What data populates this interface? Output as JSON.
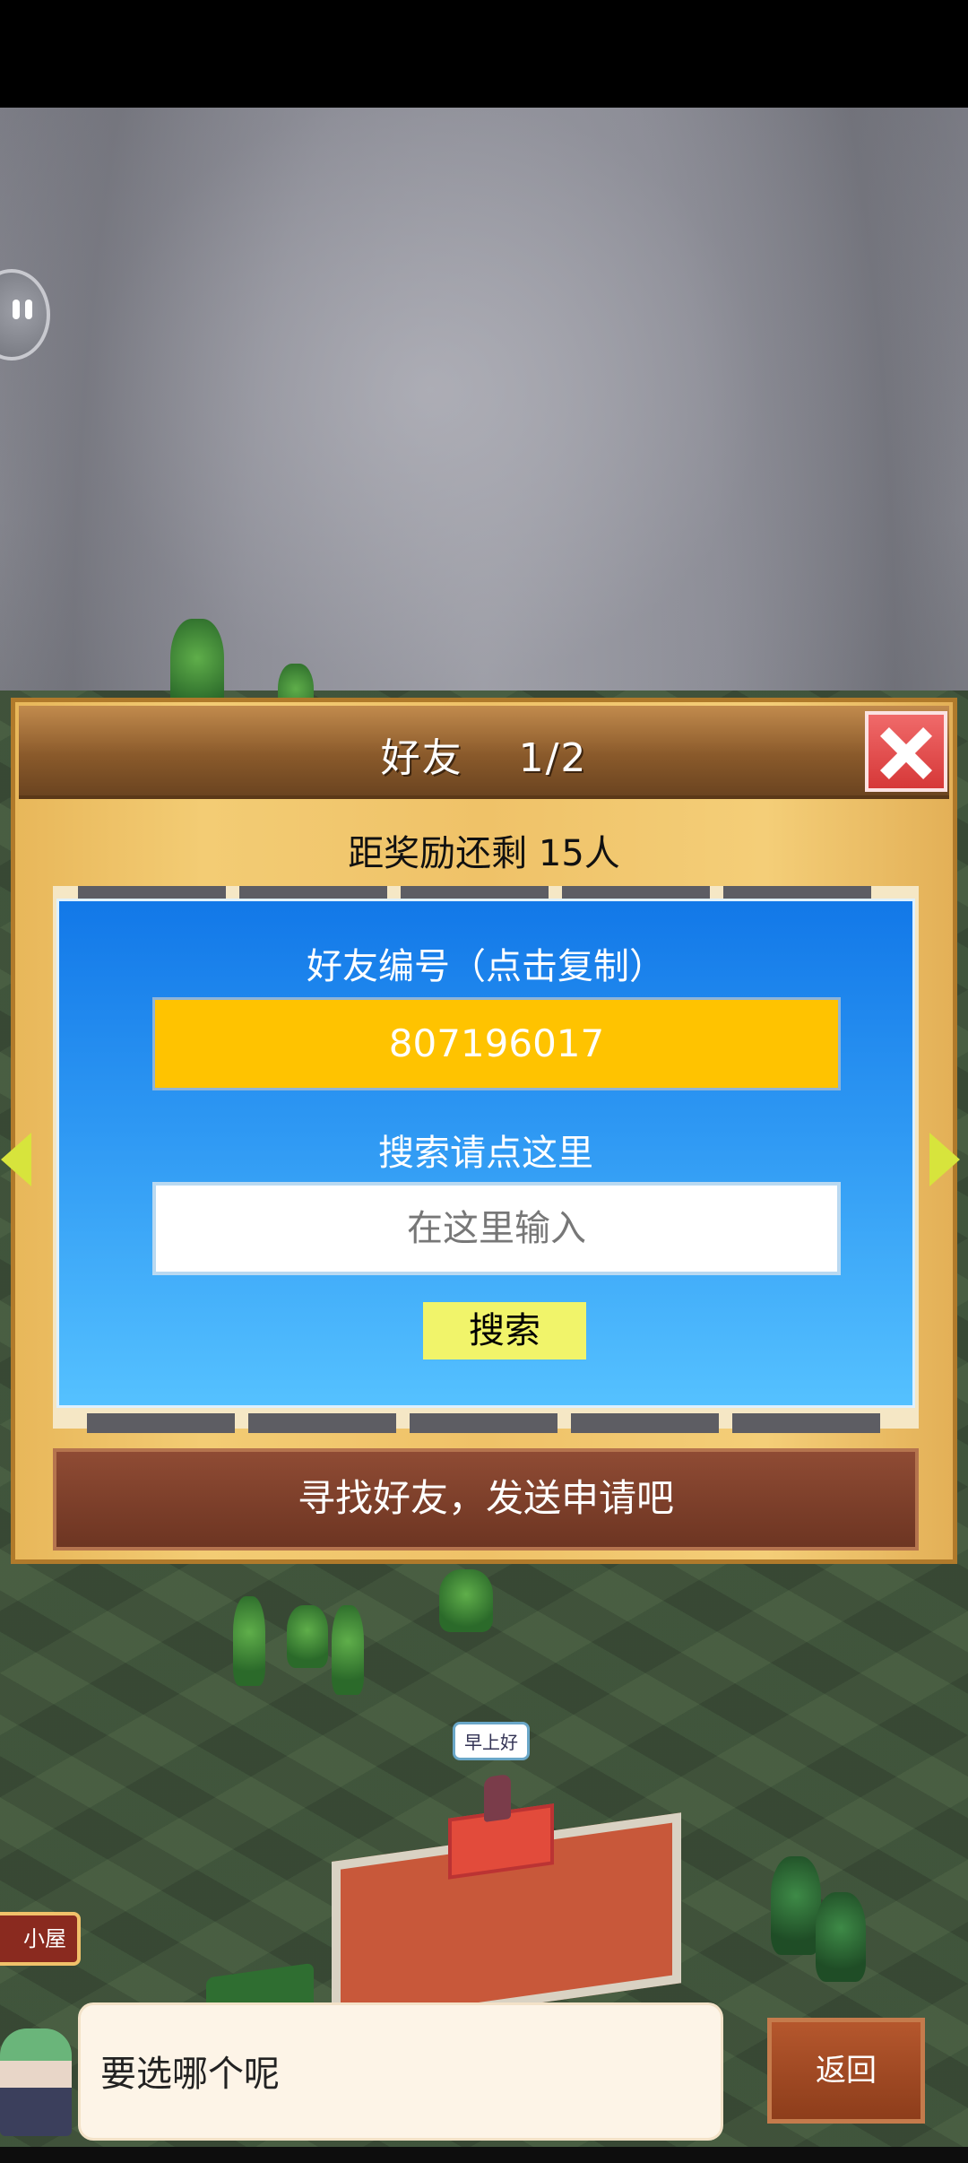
{
  "dialog": {
    "title": "好友　 1/2",
    "remaining": "距奖励还剩 15人",
    "friend_id_label": "好友编号（点击复制）",
    "friend_id": "807196017",
    "search_label": "搜索请点这里",
    "search_placeholder": "在这里输入",
    "search_button": "搜索",
    "find_friends": "寻找好友，发送申请吧"
  },
  "scene": {
    "greeting_bubble": "早上好",
    "hut_label": "小屋"
  },
  "bottom": {
    "message": "要选哪个呢",
    "back_button": "返回"
  },
  "icons": {
    "close": "close-icon",
    "prev": "arrow-left-icon",
    "next": "arrow-right-icon",
    "chat": "chat-bubble-icon"
  },
  "colors": {
    "panel_blue": "#2e98f3",
    "id_box": "#ffc300",
    "search_button": "#f1f46a",
    "close_red": "#d63838"
  }
}
